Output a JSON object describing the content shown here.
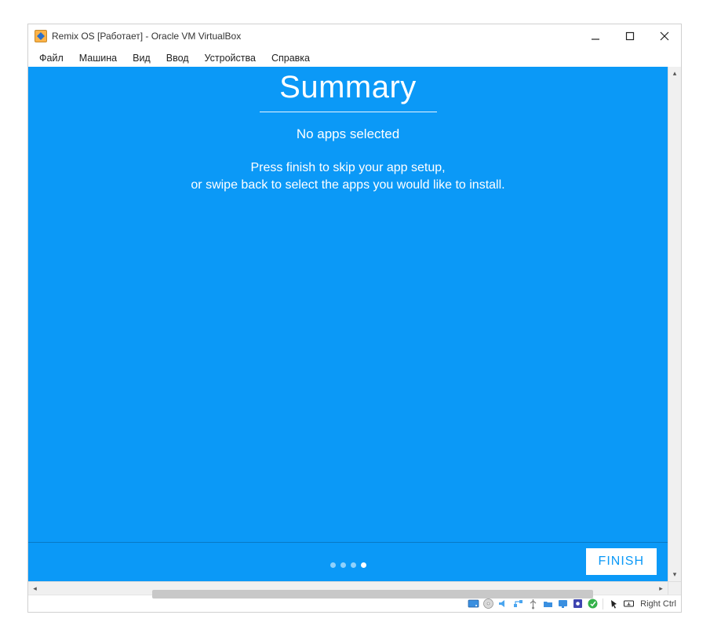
{
  "window": {
    "title": "Remix OS [Работает] - Oracle VM VirtualBox"
  },
  "menu": {
    "file": "Файл",
    "machine": "Машина",
    "view": "Вид",
    "input": "Ввод",
    "devices": "Устройства",
    "help": "Справка"
  },
  "screen": {
    "heading": "Summary",
    "subtitle": "No apps selected",
    "line1": "Press finish to skip your app setup,",
    "line2": "or swipe back to select the apps you would like to install.",
    "finish": "FINISH",
    "page_count": 4,
    "page_active_index": 3
  },
  "status": {
    "host_key": "Right Ctrl"
  }
}
